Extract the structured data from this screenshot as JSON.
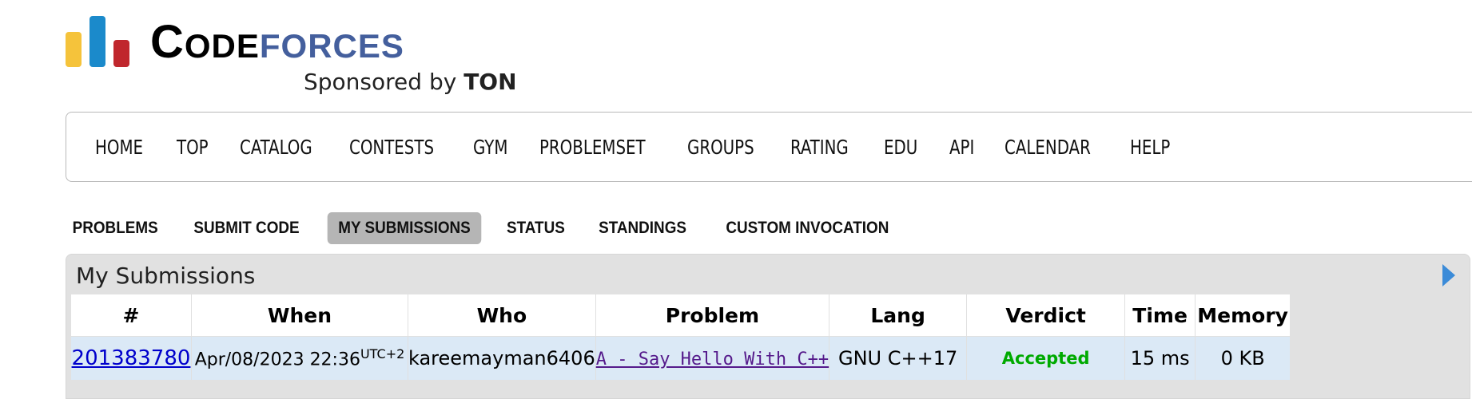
{
  "logo": {
    "code_first": "C",
    "code_rest": "ODE",
    "forces": "FORCES",
    "sponsor_prefix": "Sponsored by",
    "sponsor_name": "TON"
  },
  "main_nav": [
    "HOME",
    "TOP",
    "CATALOG",
    "CONTESTS",
    "GYM",
    "PROBLEMSET",
    "GROUPS",
    "RATING",
    "EDU",
    "API",
    "CALENDAR",
    "HELP"
  ],
  "second_menu": {
    "items": [
      "PROBLEMS",
      "SUBMIT CODE",
      "MY SUBMISSIONS",
      "STATUS",
      "STANDINGS",
      "CUSTOM INVOCATION"
    ],
    "active": "MY SUBMISSIONS"
  },
  "submissions": {
    "title": "My Submissions",
    "columns": [
      "#",
      "When",
      "Who",
      "Problem",
      "Lang",
      "Verdict",
      "Time",
      "Memory"
    ],
    "rows": [
      {
        "id": "201383780",
        "when": "Apr/08/2023 22:36",
        "tz": "UTC+2",
        "who": "kareemayman6406",
        "problem": "A - Say Hello With C++",
        "lang": "GNU C++17",
        "verdict": "Accepted",
        "time": "15 ms",
        "memory": "0 KB"
      }
    ]
  },
  "colors": {
    "brand_blue": "#445f9d",
    "verdict_accepted": "#00aa00",
    "active_tab_bg": "#b5b5b5",
    "row_highlight": "#dbe9f6"
  },
  "icons": {
    "logo": "codeforces-bars-logo",
    "box_toggle": "triangle-right-icon"
  }
}
